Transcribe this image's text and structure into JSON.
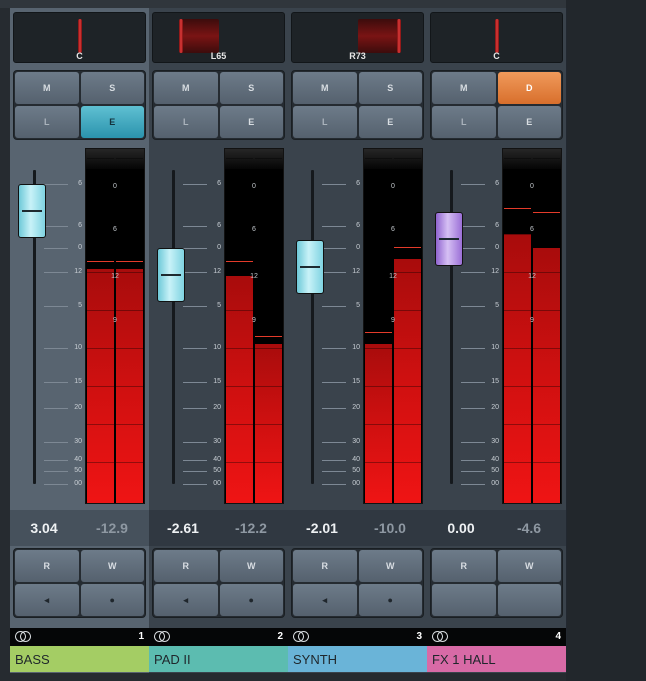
{
  "colors": {
    "fader_cap_audio": "#a8e4ee",
    "fader_cap_fx": "#c3a8ec",
    "meter_red": "#e01212",
    "edit_active": "#3fa9c2",
    "disable_active": "#e6823d"
  },
  "fader_scale": [
    "6",
    "6",
    "0",
    "12",
    "5",
    "10",
    "15",
    "20",
    "30",
    "40",
    "50",
    "00"
  ],
  "fader_scale_values": [
    6,
    6,
    0,
    12,
    5,
    10,
    15,
    20,
    30,
    40,
    50,
    99
  ],
  "meter_scale": [
    "0",
    "6",
    "12",
    "9"
  ],
  "channels": [
    {
      "number": "1",
      "name": "BASS",
      "name_color": "#a4cd64",
      "pan_label": "C",
      "pan_value": 0,
      "buttons": {
        "mute": "M",
        "solo": "S",
        "listen": "L",
        "edit": "E",
        "read": "R",
        "write": "W"
      },
      "edit_active": true,
      "disable_active": false,
      "selected": true,
      "volume": "3.04",
      "peak": "-12.9",
      "volume_db": 3.04,
      "meter_fill": [
        0.66,
        0.66
      ],
      "meter_peak": [
        0.68,
        0.68
      ],
      "cap": "cyan",
      "bottom_icons": [
        "speaker-icon",
        "record-dot-icon"
      ]
    },
    {
      "number": "2",
      "name": "PAD II",
      "name_color": "#5cbcb0",
      "pan_label": "L65",
      "pan_value": -65,
      "buttons": {
        "mute": "M",
        "solo": "S",
        "listen": "L",
        "edit": "E",
        "read": "R",
        "write": "W"
      },
      "edit_active": false,
      "disable_active": false,
      "selected": false,
      "volume": "-2.61",
      "peak": "-12.2",
      "volume_db": -2.61,
      "meter_fill": [
        0.64,
        0.45
      ],
      "meter_peak": [
        0.68,
        0.47
      ],
      "cap": "cyan",
      "bottom_icons": [
        "speaker-icon",
        "record-dot-icon"
      ]
    },
    {
      "number": "3",
      "name": "SYNTH",
      "name_color": "#6ab4d8",
      "pan_label": "R73",
      "pan_value": 73,
      "buttons": {
        "mute": "M",
        "solo": "S",
        "listen": "L",
        "edit": "E",
        "read": "R",
        "write": "W"
      },
      "edit_active": false,
      "disable_active": false,
      "selected": false,
      "volume": "-2.01",
      "peak": "-10.0",
      "volume_db": -2.01,
      "meter_fill": [
        0.45,
        0.69
      ],
      "meter_peak": [
        0.48,
        0.72
      ],
      "cap": "cyan",
      "bottom_icons": [
        "speaker-icon",
        "record-dot-icon"
      ]
    },
    {
      "number": "4",
      "name": "FX 1 HALL",
      "name_color": "#d86aa6",
      "pan_label": "C",
      "pan_value": 0,
      "buttons": {
        "mute": "M",
        "solo": "D",
        "listen": "L",
        "edit": "E",
        "read": "R",
        "write": "W"
      },
      "edit_active": false,
      "disable_active": true,
      "selected": false,
      "volume": "0.00",
      "peak": "-4.6",
      "volume_db": 0,
      "meter_fill": [
        0.76,
        0.72
      ],
      "meter_peak": [
        0.83,
        0.82
      ],
      "cap": "purple",
      "bottom_icons": []
    }
  ]
}
